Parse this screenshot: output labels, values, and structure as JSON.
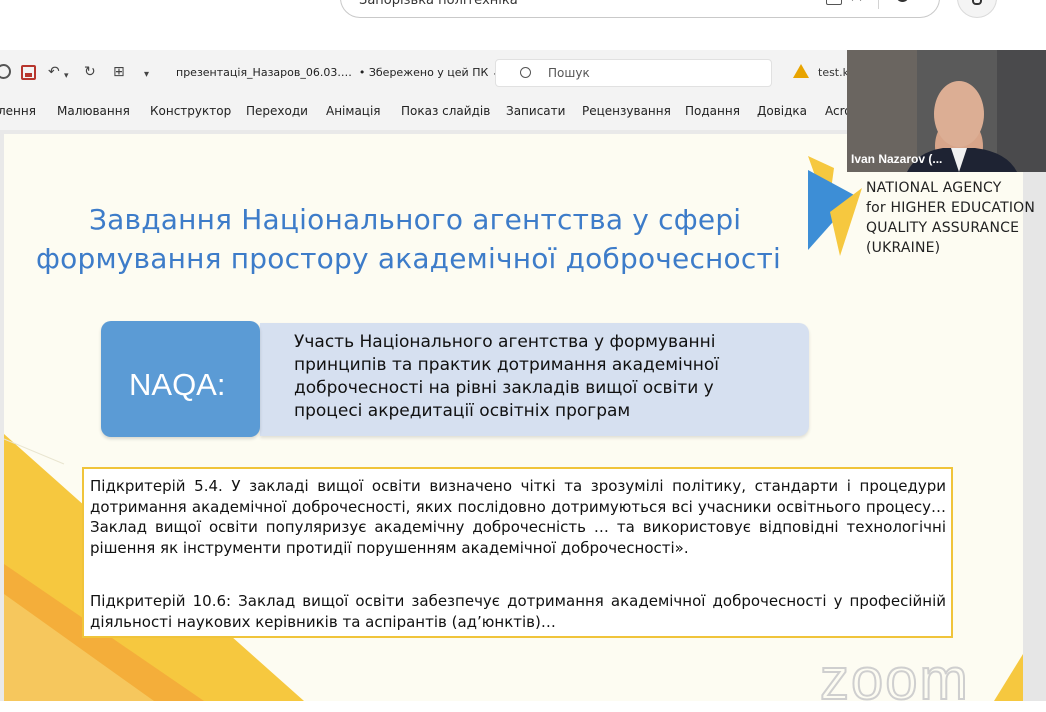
{
  "browser": {
    "search_text": "Запорізька політехніка"
  },
  "app": {
    "filename": "презентація_Назаров_06.03.…",
    "save_status": "• Збережено у цей ПК",
    "search_placeholder": "Пошук",
    "warning_file": "test.k"
  },
  "ribbon": {
    "tabs": [
      "лення",
      "Малювання",
      "Конструктор",
      "Переходи",
      "Анімація",
      "Показ слайдів",
      "Записати",
      "Рецензування",
      "Подання",
      "Довідка",
      "Acro"
    ]
  },
  "slide": {
    "title_line1": "Завдання Національного агентства у сфері",
    "title_line2": "формування простору академічної доброчесності",
    "naqa_label": "NAQA:",
    "naqa_description": "Участь Національного агентства у формуванні принципів та практик дотримання академічної доброчесності на рівні закладів вищої освіти у процесі акредитації освітніх програм",
    "criterion_1": "Підкритерій 5.4. У закладі вищої освіти визначено чіткі та зрозумілі політику, стандарти і процедури дотримання академічної доброчесності, яких послідовно дотримуються всі учасники освітнього процесу… Заклад вищої освіти популяризує академічну доброчесність … та використовує відповідні технологічні рішення як інструменти протидії порушенням академічної доброчесності».",
    "criterion_2": "Підкритерій 10.6: Заклад вищої освіти забезпечує дотримання академічної доброчесності у професійній діяльності наукових керівників та аспірантів (ад’юнктів)…",
    "logo_lines": [
      "NATIONAL AGENCY",
      "for HIGHER EDUCATION",
      "QUALITY ASSURANCE",
      "(UKRAINE)"
    ]
  },
  "video": {
    "participant_name": "Ivan Nazarov (..."
  },
  "watermark": "zoom",
  "colors": {
    "title_blue": "#3d7cc9",
    "naqa_blue": "#5b9bd5",
    "desc_bg": "#d6e0f0",
    "criteria_border": "#f0c43a",
    "accent_yellow": "#f6c83f"
  }
}
